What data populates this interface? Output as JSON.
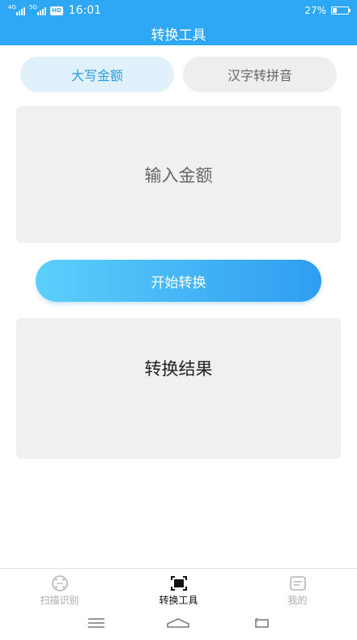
{
  "status_bar": {
    "network_1": "4G",
    "network_2": "5G",
    "hd": "HD",
    "time": "16:01",
    "battery": "27%",
    "battery_level": 0.27
  },
  "header": {
    "title": "转换工具"
  },
  "tabs": [
    {
      "label": "大写金额",
      "active": true
    },
    {
      "label": "汉字转拼音",
      "active": false
    }
  ],
  "input": {
    "placeholder": "输入金额"
  },
  "convert_button": {
    "label": "开始转换"
  },
  "result": {
    "text": "转换结果"
  },
  "bottom_nav": [
    {
      "label": "扫描识别",
      "icon": "scan-icon",
      "active": false
    },
    {
      "label": "转换工具",
      "icon": "convert-tool-icon",
      "active": true
    },
    {
      "label": "我的",
      "icon": "profile-icon",
      "active": false
    }
  ],
  "system_nav": [
    "menu-icon",
    "home-icon",
    "back-icon"
  ],
  "colors": {
    "primary": "#2ea7f4",
    "tab_active_bg": "#e0f1fc",
    "tab_active_text": "#2b9ee3",
    "panel_bg": "#f0f0f0"
  }
}
